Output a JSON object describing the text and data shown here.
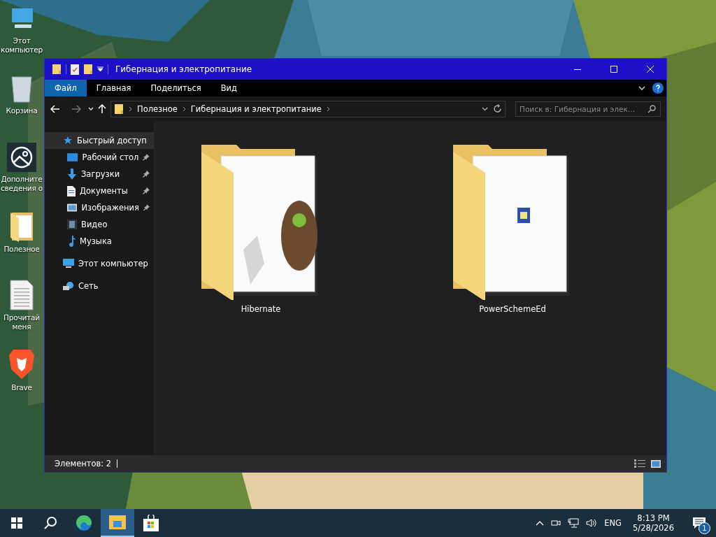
{
  "desktop": {
    "icons": [
      {
        "label": "Этот компьютер",
        "kind": "computer"
      },
      {
        "label": "Корзина",
        "kind": "bin"
      },
      {
        "label": "Дополните сведения о",
        "kind": "info"
      },
      {
        "label": "Полезное",
        "kind": "folder"
      },
      {
        "label": "Прочитай меня",
        "kind": "document"
      },
      {
        "label": "Brave",
        "kind": "brave"
      }
    ]
  },
  "window": {
    "title": "Гибернация и электропитание",
    "ribbon_tabs": [
      {
        "label": "Файл",
        "selected": true
      },
      {
        "label": "Главная",
        "selected": false
      },
      {
        "label": "Поделиться",
        "selected": false
      },
      {
        "label": "Вид",
        "selected": false
      }
    ],
    "address": {
      "path": [
        "Полезное",
        "Гибернация и электропитание"
      ]
    },
    "search": {
      "placeholder": "Поиск в: Гибернация и элек…"
    },
    "nav": [
      {
        "label": "Быстрый доступ",
        "kind": "star",
        "selected": true,
        "children": [
          {
            "label": "Рабочий стол",
            "kind": "desktop",
            "pinned": true,
            "selected": false
          },
          {
            "label": "Загрузки",
            "kind": "download",
            "pinned": true,
            "selected": false
          },
          {
            "label": "Документы",
            "kind": "documents",
            "pinned": true,
            "selected": false
          },
          {
            "label": "Изображения",
            "kind": "pictures",
            "pinned": true,
            "selected": false
          },
          {
            "label": "Видео",
            "kind": "video",
            "pinned": false,
            "selected": false
          },
          {
            "label": "Музыка",
            "kind": "music",
            "pinned": false,
            "selected": false
          }
        ]
      },
      {
        "label": "Этот компьютер",
        "kind": "pc",
        "selected": false
      },
      {
        "label": "Сеть",
        "kind": "network",
        "selected": false
      }
    ],
    "items": [
      {
        "name": "Hibernate",
        "kind": "owl"
      },
      {
        "name": "PowerSchemeEd",
        "kind": "app"
      }
    ],
    "status": "Элементов: 2"
  },
  "taskbar": {
    "apps": [
      {
        "kind": "start",
        "selected": false
      },
      {
        "kind": "search",
        "selected": false
      },
      {
        "kind": "edge",
        "selected": false
      },
      {
        "kind": "explorer",
        "selected": true
      },
      {
        "kind": "store",
        "selected": false
      }
    ],
    "language": "ENG",
    "time": "8:13 PM",
    "date": "5/28/2026",
    "notifications": "1"
  }
}
